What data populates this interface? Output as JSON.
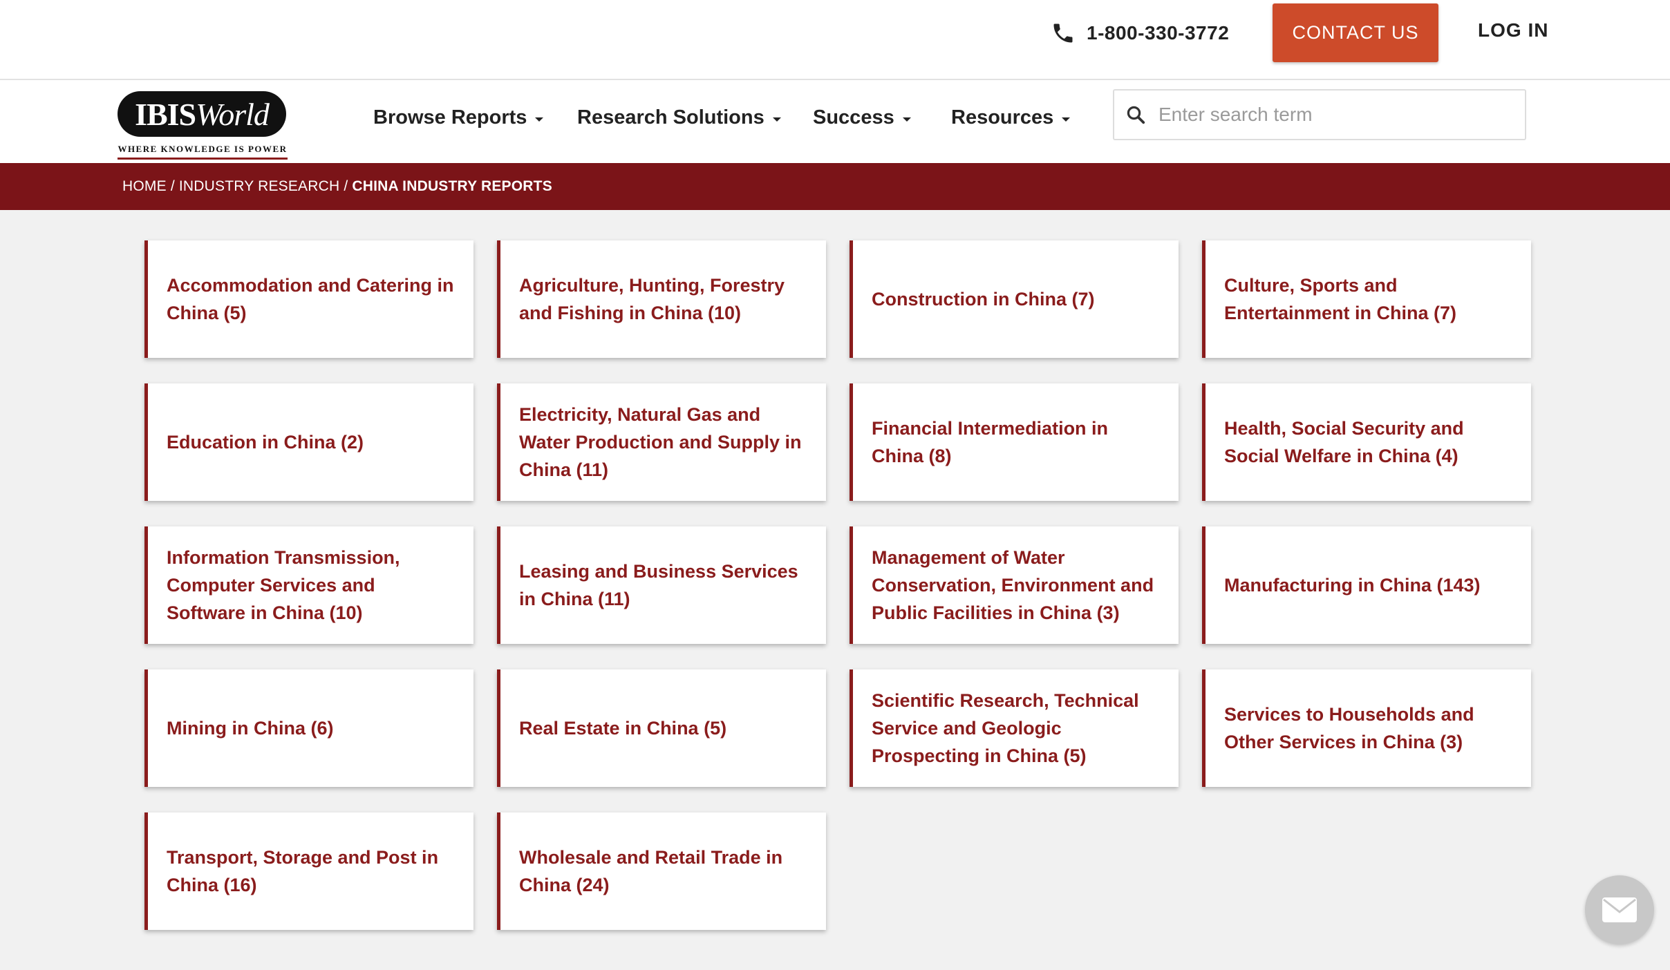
{
  "header": {
    "phone": "1-800-330-3772",
    "contact_label": "CONTACT US",
    "login_label": "LOG IN"
  },
  "logo": {
    "word_bold": "IBIS",
    "word_italic": "World",
    "tagline": "WHERE KNOWLEDGE IS POWER"
  },
  "nav": {
    "items": [
      {
        "label": "Browse Reports"
      },
      {
        "label": "Research Solutions"
      },
      {
        "label": "Success"
      },
      {
        "label": "Resources"
      }
    ],
    "search_placeholder": "Enter search term"
  },
  "breadcrumb": {
    "home": "HOME",
    "section": "INDUSTRY RESEARCH",
    "current": "CHINA INDUSTRY REPORTS",
    "separator": "/"
  },
  "categories": [
    "Accommodation and Catering in China (5)",
    "Agriculture, Hunting, Forestry and Fishing in China (10)",
    "Construction in China (7)",
    "Culture, Sports and Entertainment in China (7)",
    "Education in China (2)",
    "Electricity, Natural Gas and Water Production and Supply in China (11)",
    "Financial Intermediation in China (8)",
    "Health, Social Security and Social Welfare in China (4)",
    "Information Transmission, Computer Services and Software in China (10)",
    "Leasing and Business Services in China (11)",
    "Management of Water Conservation, Environment and Public Facilities in China (3)",
    "Manufacturing in China (143)",
    "Mining in China (6)",
    "Real Estate in China (5)",
    "Scientific Research, Technical Service and Geologic Prospecting in China (5)",
    "Services to Households and Other Services in China (3)",
    "Transport, Storage and Post in China (16)",
    "Wholesale and Retail Trade in China (24)"
  ],
  "colors": {
    "brand_red": "#7b1418",
    "card_accent": "#8a1c1c",
    "contact_button": "#cd4b2a"
  },
  "icons": {
    "phone": "phone-icon",
    "search": "search-icon",
    "chat": "envelope-icon"
  }
}
